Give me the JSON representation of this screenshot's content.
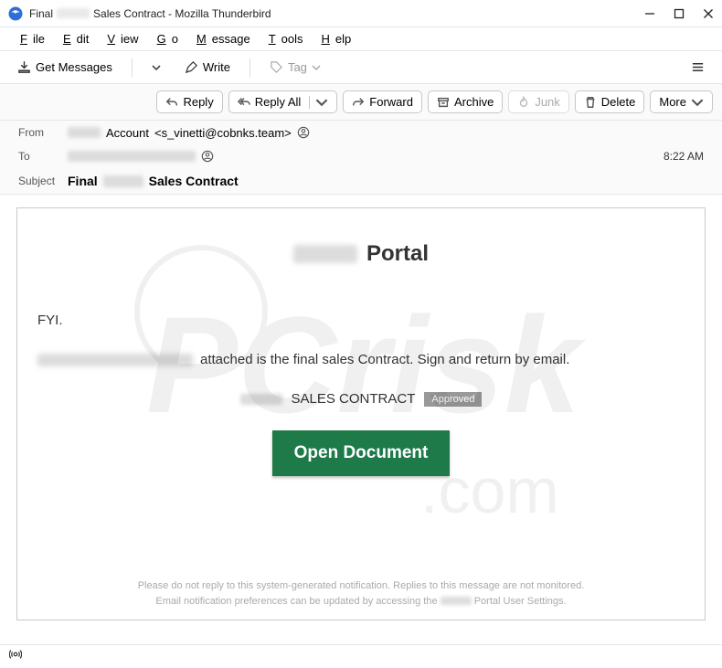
{
  "window": {
    "title_prefix": "Final",
    "title_suffix": "Sales Contract - Mozilla Thunderbird"
  },
  "menubar": [
    "File",
    "Edit",
    "View",
    "Go",
    "Message",
    "Tools",
    "Help"
  ],
  "toolbar": {
    "get_messages": "Get Messages",
    "write": "Write",
    "tag": "Tag"
  },
  "actions": {
    "reply": "Reply",
    "reply_all": "Reply All",
    "forward": "Forward",
    "archive": "Archive",
    "junk": "Junk",
    "delete": "Delete",
    "more": "More"
  },
  "headers": {
    "from_label": "From",
    "from_name_suffix": "Account",
    "from_addr": "<s_vinetti@cobnks.team>",
    "to_label": "To",
    "subject_label": "Subject",
    "subject_prefix": "Final",
    "subject_suffix": "Sales Contract",
    "time": "8:22 AM"
  },
  "body": {
    "portal_suffix": "Portal",
    "fyi": "FYI.",
    "attached_line": "attached is the final sales Contract. Sign and return by email.",
    "contract_label": "SALES CONTRACT",
    "status_badge": "Approved",
    "open_button": "Open Document",
    "footnote_1": "Please do not reply to this system-generated notification. Replies to this message are not monitored.",
    "footnote_2a": "Email notification preferences can be updated by accessing the",
    "footnote_2b": "Portal User Settings."
  }
}
